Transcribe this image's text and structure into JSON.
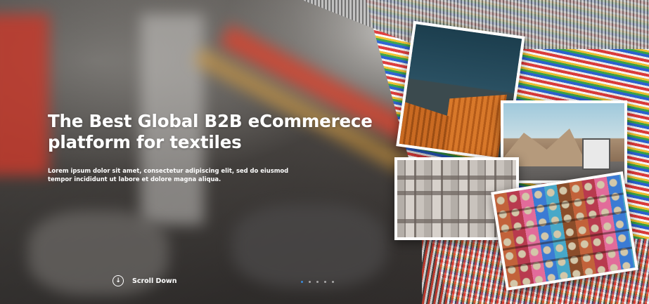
{
  "hero": {
    "title": "The Best Global B2B eCommerece platform for textiles",
    "lead": "Lorem ipsum dolor sit amet, consectetur adipiscing elit, sed do eiusmod tempor incididunt ut labore et dolore magna aliqua.",
    "scroll_label": "Scroll Down",
    "scroll_icon": "arrow-down-circle-icon",
    "slides_total": 5,
    "active_slide": 1,
    "accent_color": "#3a8dde"
  }
}
